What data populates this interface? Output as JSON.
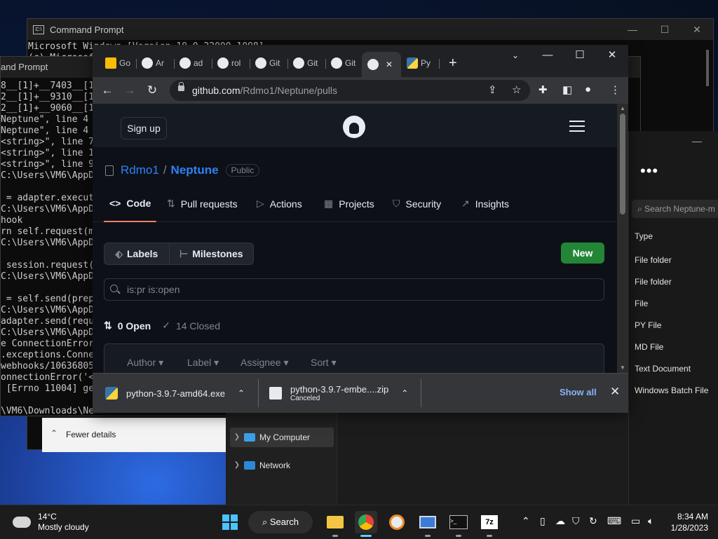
{
  "cmd_back": {
    "title": "Command Prompt",
    "lines": [
      "Microsoft Windows [Version 10.0.22000.1098]",
      "(c) Microsoft"
    ]
  },
  "cmd_front": {
    "title": "and Prompt",
    "lines": [
      "8__[1]+__7403__[1]",
      "2__[1]+__9310__[1]",
      "2__[1]+__9060__[1]",
      "Neptune\", line 4",
      "Neptune\", line 4",
      "<string>\", line 7",
      "<string>\", line 1",
      "<string>\", line 9",
      "C:\\Users\\VM6\\AppD",
      "",
      " = adapter.execut",
      "C:\\Users\\VM6\\AppD",
      "hook",
      "rn self.request(m",
      "C:\\Users\\VM6\\AppD",
      "",
      " session.request(",
      "C:\\Users\\VM6\\AppD",
      "",
      " = self.send(prep",
      "C:\\Users\\VM6\\AppD",
      "adapter.send(requ",
      "C:\\Users\\VM6\\AppD",
      "e ConnectionError",
      ".exceptions.Conne",
      "webhooks/10636805",
      "onnectionError('<",
      " [Errno 11004] ge",
      "",
      "\\VM6\\Downloads\\Ne"
    ]
  },
  "explorer_right": {
    "search_placeholder": "Search Neptune-m",
    "column_header": "Type",
    "types": [
      "File folder",
      "File folder",
      "File",
      "PY File",
      "MD File",
      "Text Document",
      "Windows Batch File"
    ]
  },
  "explorer_bottom": {
    "nav": [
      {
        "label": "My Computer"
      },
      {
        "label": "Network"
      }
    ],
    "fewer_details": "Fewer details"
  },
  "chrome": {
    "tabs": [
      "Go",
      "Ar",
      "ad",
      "rol",
      "Git",
      "Git",
      "Git",
      "",
      "Py"
    ],
    "url_host": "github.com",
    "url_path": "/Rdmo1/Neptune/pulls"
  },
  "github": {
    "signup": "Sign up",
    "owner": "Rdmo1",
    "repo": "Neptune",
    "visibility": "Public",
    "tabs": [
      "Code",
      "Pull requests",
      "Actions",
      "Projects",
      "Security",
      "Insights"
    ],
    "labels_btn": "Labels",
    "milestones_btn": "Milestones",
    "new_btn": "New",
    "filter_value": "is:pr is:open",
    "open_count": "0 Open",
    "closed_count": "14 Closed",
    "filters": [
      "Author",
      "Label",
      "Assignee",
      "Sort"
    ]
  },
  "downloads": {
    "items": [
      {
        "name": "python-3.9.7-amd64.exe",
        "status": ""
      },
      {
        "name": "python-3.9.7-embe....zip",
        "status": "Canceled"
      }
    ],
    "show_all": "Show all"
  },
  "taskbar": {
    "temp": "14°C",
    "weather": "Mostly cloudy",
    "search": "Search",
    "time": "8:34 AM",
    "date": "1/28/2023"
  }
}
